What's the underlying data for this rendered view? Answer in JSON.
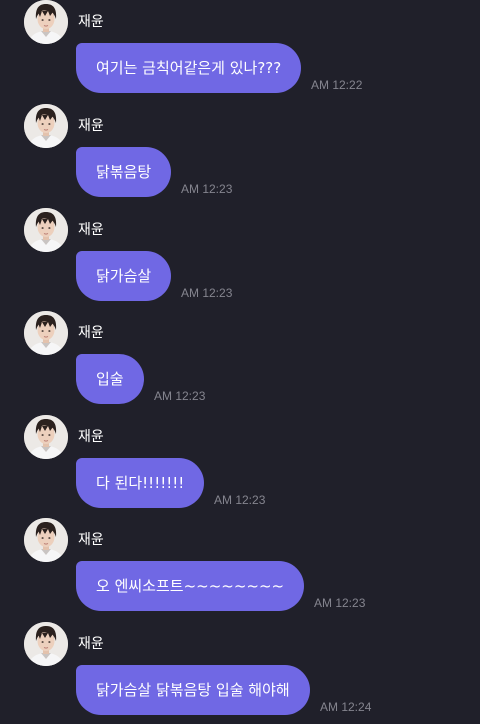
{
  "messages": [
    {
      "sender": "재윤",
      "text": "여기는 금칙어같은게 있나???",
      "time": "AM 12:22"
    },
    {
      "sender": "재윤",
      "text": "닭볶음탕",
      "time": "AM 12:23"
    },
    {
      "sender": "재윤",
      "text": "닭가슴살",
      "time": "AM 12:23"
    },
    {
      "sender": "재윤",
      "text": "입술",
      "time": "AM 12:23"
    },
    {
      "sender": "재윤",
      "text": "다 된다!!!!!!!",
      "time": "AM 12:23"
    },
    {
      "sender": "재윤",
      "text": "오 엔씨소프트~~~~~~~~",
      "time": "AM 12:23"
    },
    {
      "sender": "재윤",
      "text": "닭가슴살 닭볶음탕 입술 해야해",
      "time": "AM 12:24"
    }
  ],
  "colors": {
    "background": "#20202a",
    "bubble": "#7068e4",
    "time": "#85858f"
  },
  "icons": {
    "avatar": "profile-photo-icon"
  }
}
